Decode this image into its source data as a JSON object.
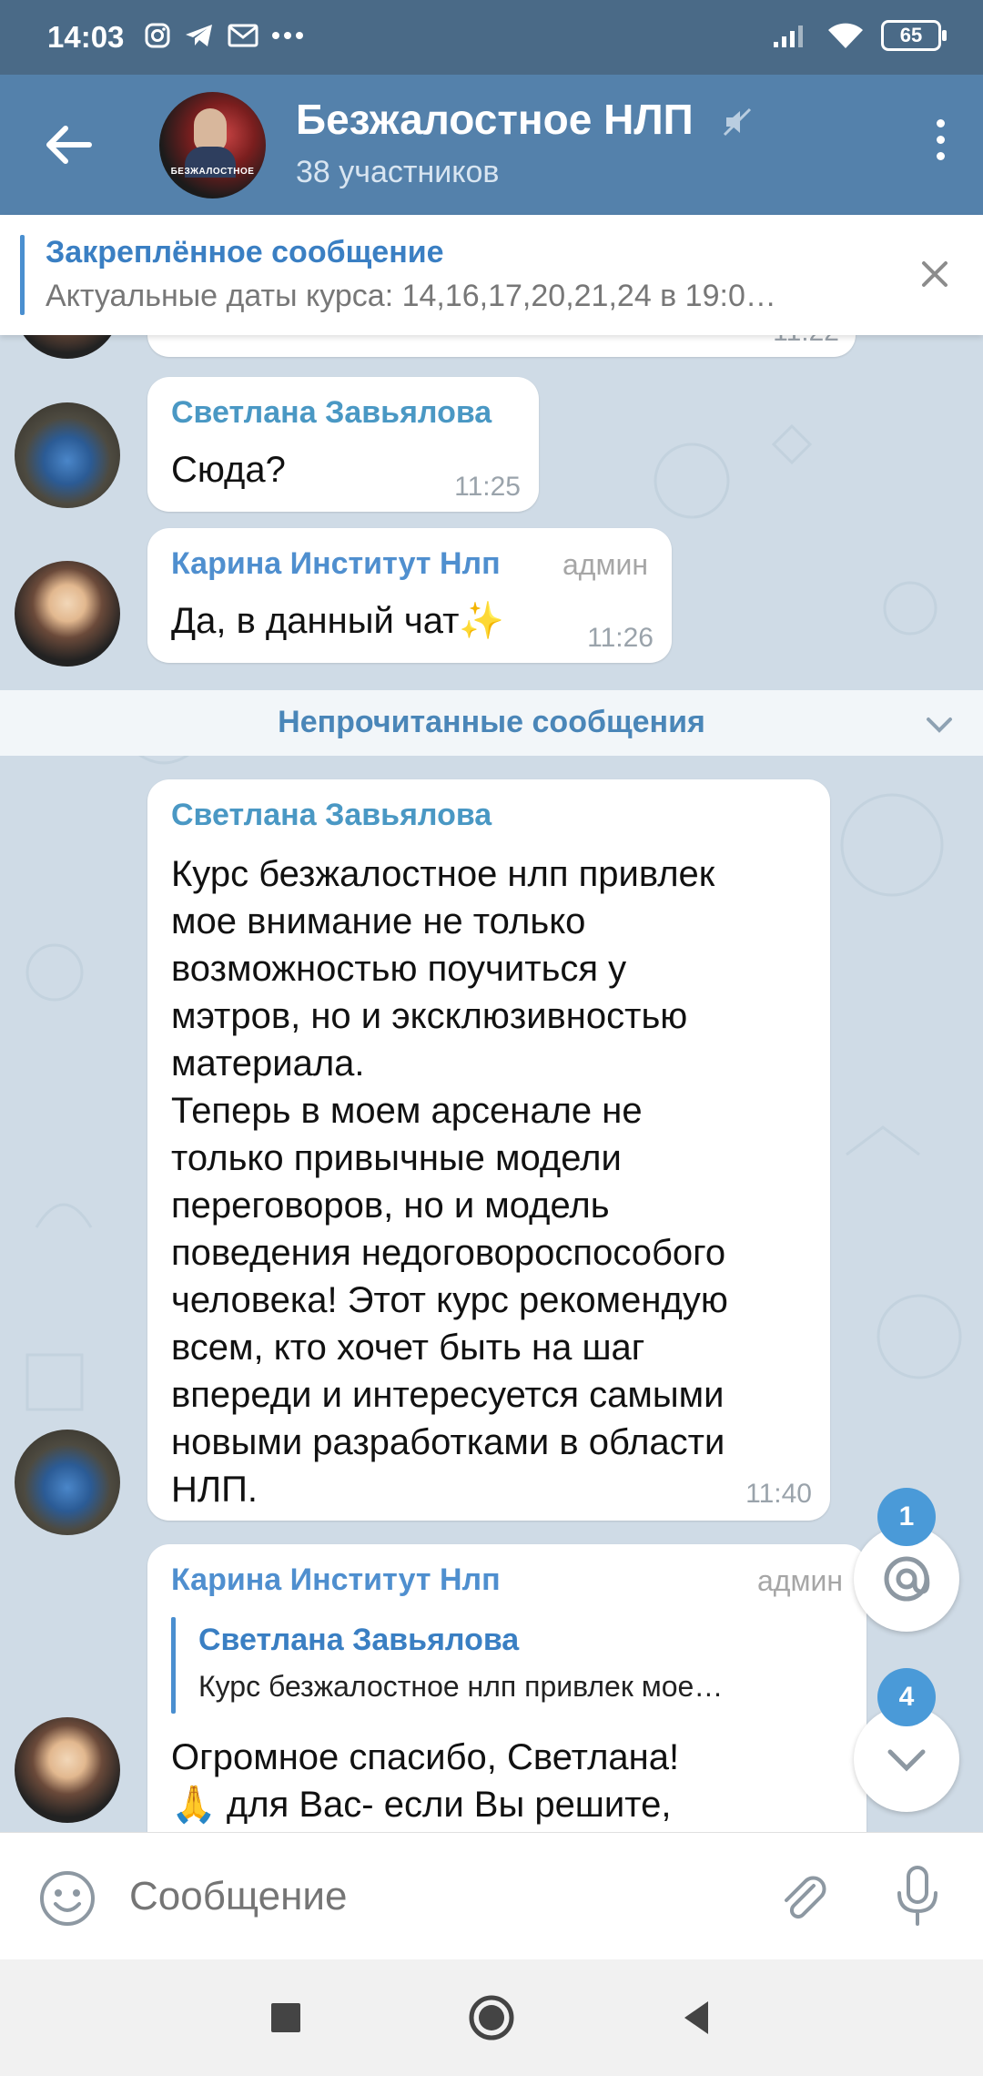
{
  "status_bar": {
    "time": "14:03",
    "battery": "65",
    "notification_icons": [
      "instagram-icon",
      "telegram-icon",
      "mail-icon",
      "more-icon"
    ]
  },
  "header": {
    "title": "Безжалостное НЛП",
    "subtitle": "38 участников",
    "avatar_text": "БЕЗЖАЛОСТНОЕ"
  },
  "pinned": {
    "title": "Закреплённое сообщение",
    "text": "Актуальные даты курса: 14,16,17,20,21,24 в 19:0…"
  },
  "partial_top": {
    "time": "11:22"
  },
  "messages": [
    {
      "author": "Светлана Завьялова",
      "text": "Сюда?",
      "time": "11:25"
    },
    {
      "author": "Карина Институт Нлп",
      "badge": "админ",
      "text": "Да, в данный чат✨",
      "time": "11:26"
    },
    {
      "author": "Светлана Завьялова",
      "text": "Курс безжалостное нлп привлек\nмое внимание не только\nвозможностью поучиться у\nмэтров, но и эксклюзивностью\nматериала.\nТеперь в моем арсенале не\nтолько привычные модели\nпереговоров, но и модель\nповедения недоговороспособого\nчеловека! Этот курс рекомендую\nвсем, кто хочет быть на шаг\nвпереди и интересуется самыми\nновыми разработками в области\nНЛП.",
      "time": "11:40"
    },
    {
      "author": "Карина Институт Нлп",
      "badge": "админ",
      "reply_author": "Светлана Завьялова",
      "reply_text": "Курс безжалостное нлп привлек мое…",
      "text": "Огромное спасибо, Светлана!\n🙏 для Вас- если Вы решите,"
    }
  ],
  "unread_divider": "Непрочитанные сообщения",
  "fab": {
    "mentions_count": "1",
    "scroll_count": "4"
  },
  "input": {
    "placeholder": "Сообщение"
  },
  "colors": {
    "header": "#5481ab",
    "status_bar": "#4a6a87",
    "chat_bg": "#cfdbe6",
    "accent": "#4a9ad8"
  }
}
